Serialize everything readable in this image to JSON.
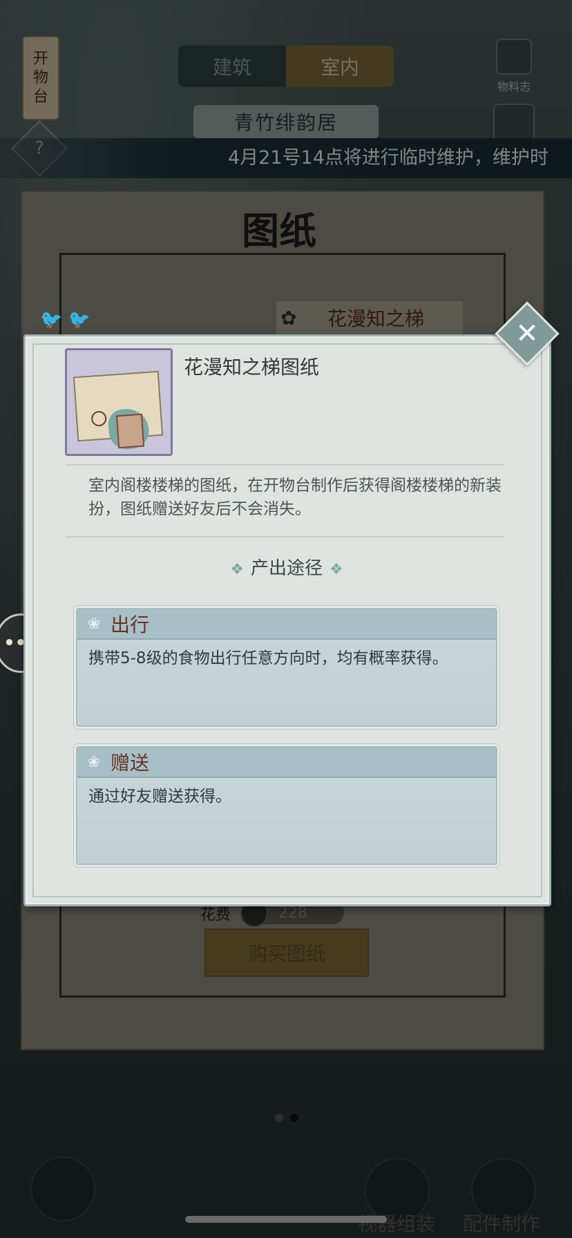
{
  "background": {
    "side_tag_text": [
      "开",
      "物",
      "台"
    ],
    "help_icon": "question-icon",
    "tabs": [
      {
        "label": "建筑",
        "active": false
      },
      {
        "label": "室内",
        "active": true
      }
    ],
    "subtitle": "青竹绯韵居",
    "right_icon_label": "物料志",
    "marquee": "4月21号14点将进行临时维护，维护时",
    "panel_title": "图纸",
    "item_name": "花漫知之梯",
    "cost_label": "花费",
    "cost_value": "228",
    "buy_button": "购买图纸",
    "bottom_left_label": "视器组装",
    "bottom_right_label": "配件制作"
  },
  "modal": {
    "title": "花漫知之梯图纸",
    "description": "室内阁楼楼梯的图纸，在开物台制作后获得阁楼楼梯的新装扮，图纸赠送好友后不会消失。",
    "section_title": "产出途径",
    "routes": [
      {
        "name": "出行",
        "text": "携带5-8级的食物出行任意方向时，均有概率获得。"
      },
      {
        "name": "赠送",
        "text": "通过好友赠送获得。"
      }
    ]
  },
  "colors": {
    "route_title": "#6a3226",
    "modal_bg": "#dfe4e1",
    "accent": "#7f9a98"
  }
}
